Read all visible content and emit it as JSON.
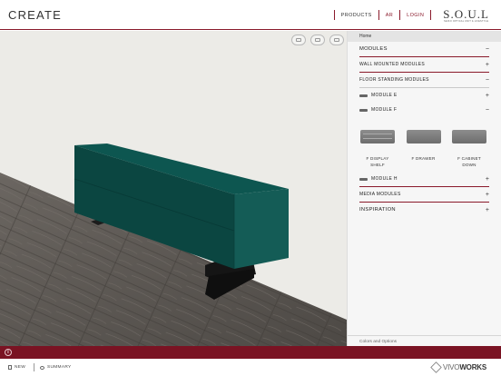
{
  "app": {
    "title": "CREATE"
  },
  "nav": {
    "products": "PRODUCTS",
    "ar": "AR",
    "login": "LOGIN"
  },
  "brand": {
    "name": "S.O.U.L",
    "tagline": "SEIKO OPTICAL UNIT & LIFESTYLE"
  },
  "panel": {
    "breadcrumb": "Home",
    "modules": "MODULES",
    "wall_mounted": "WALL MOUNTED MODULES",
    "floor_standing": "FLOOR STANDING MODULES",
    "module_e": "MODULE E",
    "module_f": "MODULE F",
    "products": [
      {
        "name": "F DISPLAY SHELF",
        "icon": "display-shelf"
      },
      {
        "name": "F DRAWER",
        "icon": "drawer"
      },
      {
        "name": "F CABINET DOWN",
        "icon": "cabinet"
      }
    ],
    "module_h": "MODULE H",
    "media_modules": "MEDIA MODULES",
    "inspiration": "INSPIRATION",
    "colors_options": "Colors and Options",
    "toggle_open": "−",
    "toggle_closed": "+"
  },
  "footer": {
    "new": "NEW",
    "summary": "SUMMARY",
    "vivo": "VIVO",
    "works": "WORKS"
  },
  "colors": {
    "accent": "#7a1323",
    "cabinet": "#0f4d48",
    "floor": "#5a5550",
    "wall": "#ecebe7"
  }
}
